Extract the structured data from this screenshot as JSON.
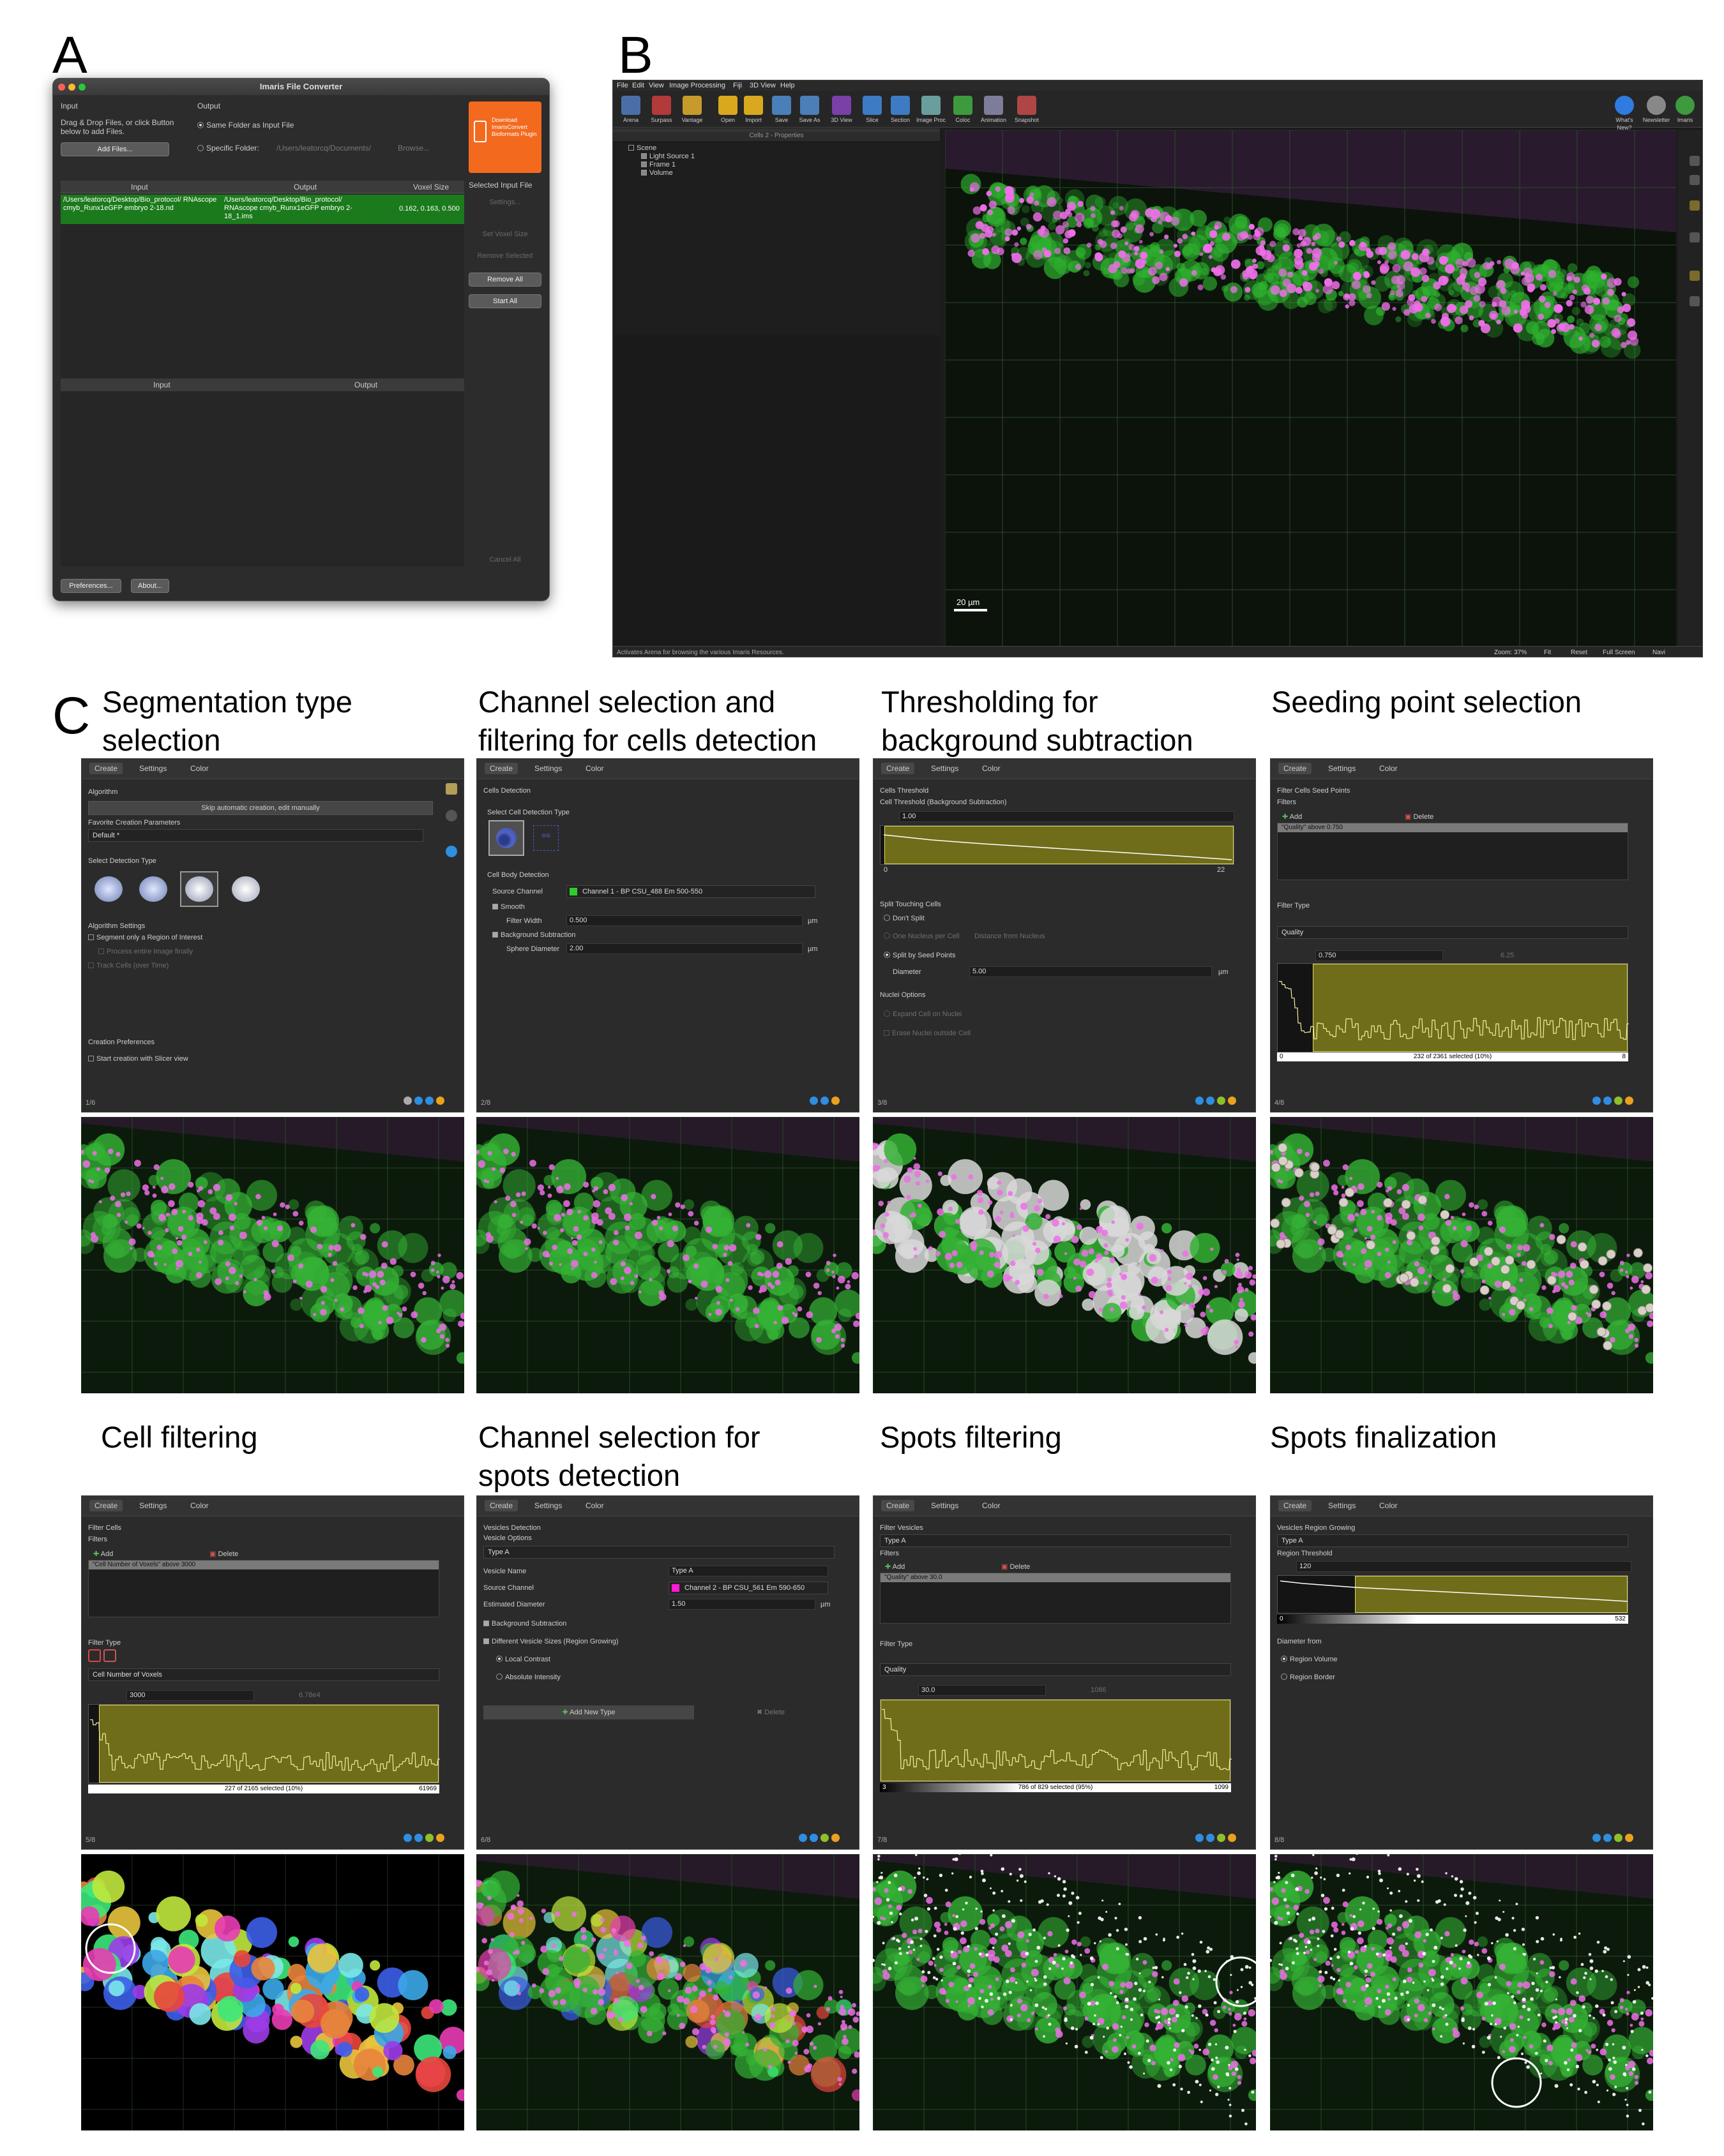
{
  "labels": {
    "a": "A",
    "b": "B",
    "c": "C"
  },
  "panel_a": {
    "title": "Imaris File Converter",
    "input_head": "Input",
    "drag_text_1": "Drag & Drop Files, or click Button",
    "drag_text_2": "below to add Files.",
    "add_files": "Add Files...",
    "output_head": "Output",
    "same_folder": "Same Folder as Input File",
    "specific_folder": "Specific Folder:",
    "folder_path": "/Users/leatorcq/Documents/",
    "browse": "Browse...",
    "promo": "Download ImarisConvert Bioformats Plugin",
    "cols": [
      "Input",
      "Output",
      "Voxel Size"
    ],
    "row": {
      "input": "/Users/leatorcq/Desktop/Bio_protocol/ RNAscope cmyb_Runx1eGFP embryo 2-18.nd",
      "output": "/Users/leatorcq/Desktop/Bio_protocol/ RNAscope cmyb_Runx1eGFP embryo 2-18_1.ims",
      "voxel": "0.162, 0.163, 0.500"
    },
    "selected_input_file": "Selected Input File",
    "settings": "Settings...",
    "set_voxel": "Set Voxel Size",
    "remove_selected": "Remove Selected",
    "remove_all": "Remove All",
    "start_all": "Start All",
    "cols2": [
      "Input",
      "Output"
    ],
    "cancel_all": "Cancel All",
    "preferences": "Preferences...",
    "about": "About..."
  },
  "panel_b": {
    "menu": [
      "File",
      "Edit",
      "View",
      "Image Processing",
      "Fiji",
      "3D View",
      "Help"
    ],
    "toolbar": [
      "Arena",
      "Surpass",
      "Vantage",
      "Open",
      "Import",
      "Save",
      "Save As",
      "3D View",
      "Slice",
      "Section",
      "Image Proc",
      "Coloc",
      "Animation",
      "Snapshot"
    ],
    "toolbar_right": [
      "What's New?",
      "Newsletter",
      "Imaris"
    ],
    "props_title": "Cells 2 - Properties",
    "tree": [
      "Scene",
      "Light Source 1",
      "Frame 1",
      "Volume"
    ],
    "scale": "20 µm",
    "status": "Activates Arena for browsing the various Imaris Resources.",
    "zoom": "Zoom: 37%",
    "status_right": [
      "Fit",
      "Reset",
      "Full Screen",
      "Navi"
    ]
  },
  "colors": {
    "brand_orange": "#f36a1f",
    "select_green": "#1b7a1b",
    "histo_yellow": "#6f6d1a",
    "cell_green": "#39c23a",
    "spot_magenta": "#e36be3"
  },
  "steps": [
    {
      "title": "Segmentation type selection"
    },
    {
      "title": "Channel selection and filtering for cells detection"
    },
    {
      "title": "Thresholding for background subtraction"
    },
    {
      "title": "Seeding point selection"
    },
    {
      "title": "Cell filtering"
    },
    {
      "title": "Channel selection for spots detection"
    },
    {
      "title": "Spots filtering"
    },
    {
      "title": "Spots finalization"
    }
  ],
  "tabs": [
    "Create",
    "Settings",
    "Color"
  ],
  "p1": {
    "algorithm": "Algorithm",
    "skip": "Skip automatic creation, edit manually",
    "fav": "Favorite Creation Parameters",
    "default": "Default *",
    "select_type": "Select Detection Type",
    "alg_settings": "Algorithm Settings",
    "roi": "Segment only a Region of Interest",
    "entire": "Process entire Image finally",
    "track": "Track Cells (over Time)",
    "prefs": "Creation Preferences",
    "slicer": "Start creation with Slicer view",
    "page": "1/6"
  },
  "p2": {
    "head": "Cells Detection",
    "sel_type": "Select Cell Detection Type",
    "body": "Cell Body Detection",
    "src": "Source Channel",
    "channel": "Channel 1 - BP CSU_488 Em 500-550",
    "smooth": "Smooth",
    "fw": "Filter Width",
    "fw_val": "0.500",
    "um": "µm",
    "bg": "Background Subtraction",
    "sd": "Sphere Diameter",
    "sd_val": "2.00",
    "page": "2/8"
  },
  "p3": {
    "head": "Cells Threshold",
    "sub": "Cell Threshold (Background Subtraction)",
    "val": "1.00",
    "hmin": "0",
    "hmax": "22",
    "split": "Split Touching Cells",
    "dont": "Don't Split",
    "one": "One Nucleus per Cell",
    "dist": "Distance from Nucleus",
    "seed": "Split by Seed Points",
    "diam": "Diameter",
    "diam_val": "5.00",
    "um": "µm",
    "nuclei": "Nuclei Options",
    "expand": "Expand Cell on Nuclei",
    "erase": "Erase Nuclei outside Cell",
    "page": "3/8"
  },
  "p4": {
    "head": "Filter Cells Seed Points",
    "filters": "Filters",
    "add": "Add",
    "del": "Delete",
    "row": "\"Quality\" above 0.750",
    "ftype": "Filter Type",
    "quality": "Quality",
    "val": "0.750",
    "val2": "6.25",
    "hmin": "0",
    "hmax": "8",
    "selected": "232 of 2361 selected (10%)",
    "page": "4/8"
  },
  "p5": {
    "head": "Filter Cells",
    "filters": "Filters",
    "add": "Add",
    "del": "Delete",
    "row": "\"Cell Number of Voxels\" above 3000",
    "ftype": "Filter Type",
    "type": "Cell Number of Voxels",
    "val": "3000",
    "val2": "6.78e4",
    "selected": "227 of 2165 selected (10%)",
    "hmax": "61969",
    "page": "5/8"
  },
  "p6": {
    "head": "Vesicles Detection",
    "opts": "Vesicle Options",
    "typeA": "Type A",
    "name": "Vesicle Name",
    "name_val": "Type A",
    "src": "Source Channel",
    "channel": "Channel 2 - BP CSU_561 Em 590-650",
    "est": "Estimated Diameter",
    "est_val": "1.50",
    "um": "µm",
    "bg": "Background Subtraction",
    "diff": "Different Vesicle Sizes (Region Growing)",
    "local": "Local Contrast",
    "abs": "Absolute Intensity",
    "add_new": "Add New Type",
    "del": "Delete",
    "page": "6/8"
  },
  "p7": {
    "head": "Filter Vesicles",
    "typeA": "Type A",
    "filters": "Filters",
    "add": "Add",
    "del": "Delete",
    "row": "\"Quality\" above 30.0",
    "ftype": "Filter Type",
    "quality": "Quality",
    "val": "30.0",
    "val2": "1086",
    "hmin": "3",
    "selected": "786 of 829 selected (95%)",
    "hmax": "1099",
    "page": "7/8"
  },
  "p8": {
    "head": "Vesicles Region Growing",
    "typeA": "Type A",
    "rt": "Region Threshold",
    "val": "120",
    "hmin": "0",
    "hmax": "532",
    "diam_from": "Diameter from",
    "vol": "Region Volume",
    "border": "Region Border",
    "page": "8/8"
  }
}
